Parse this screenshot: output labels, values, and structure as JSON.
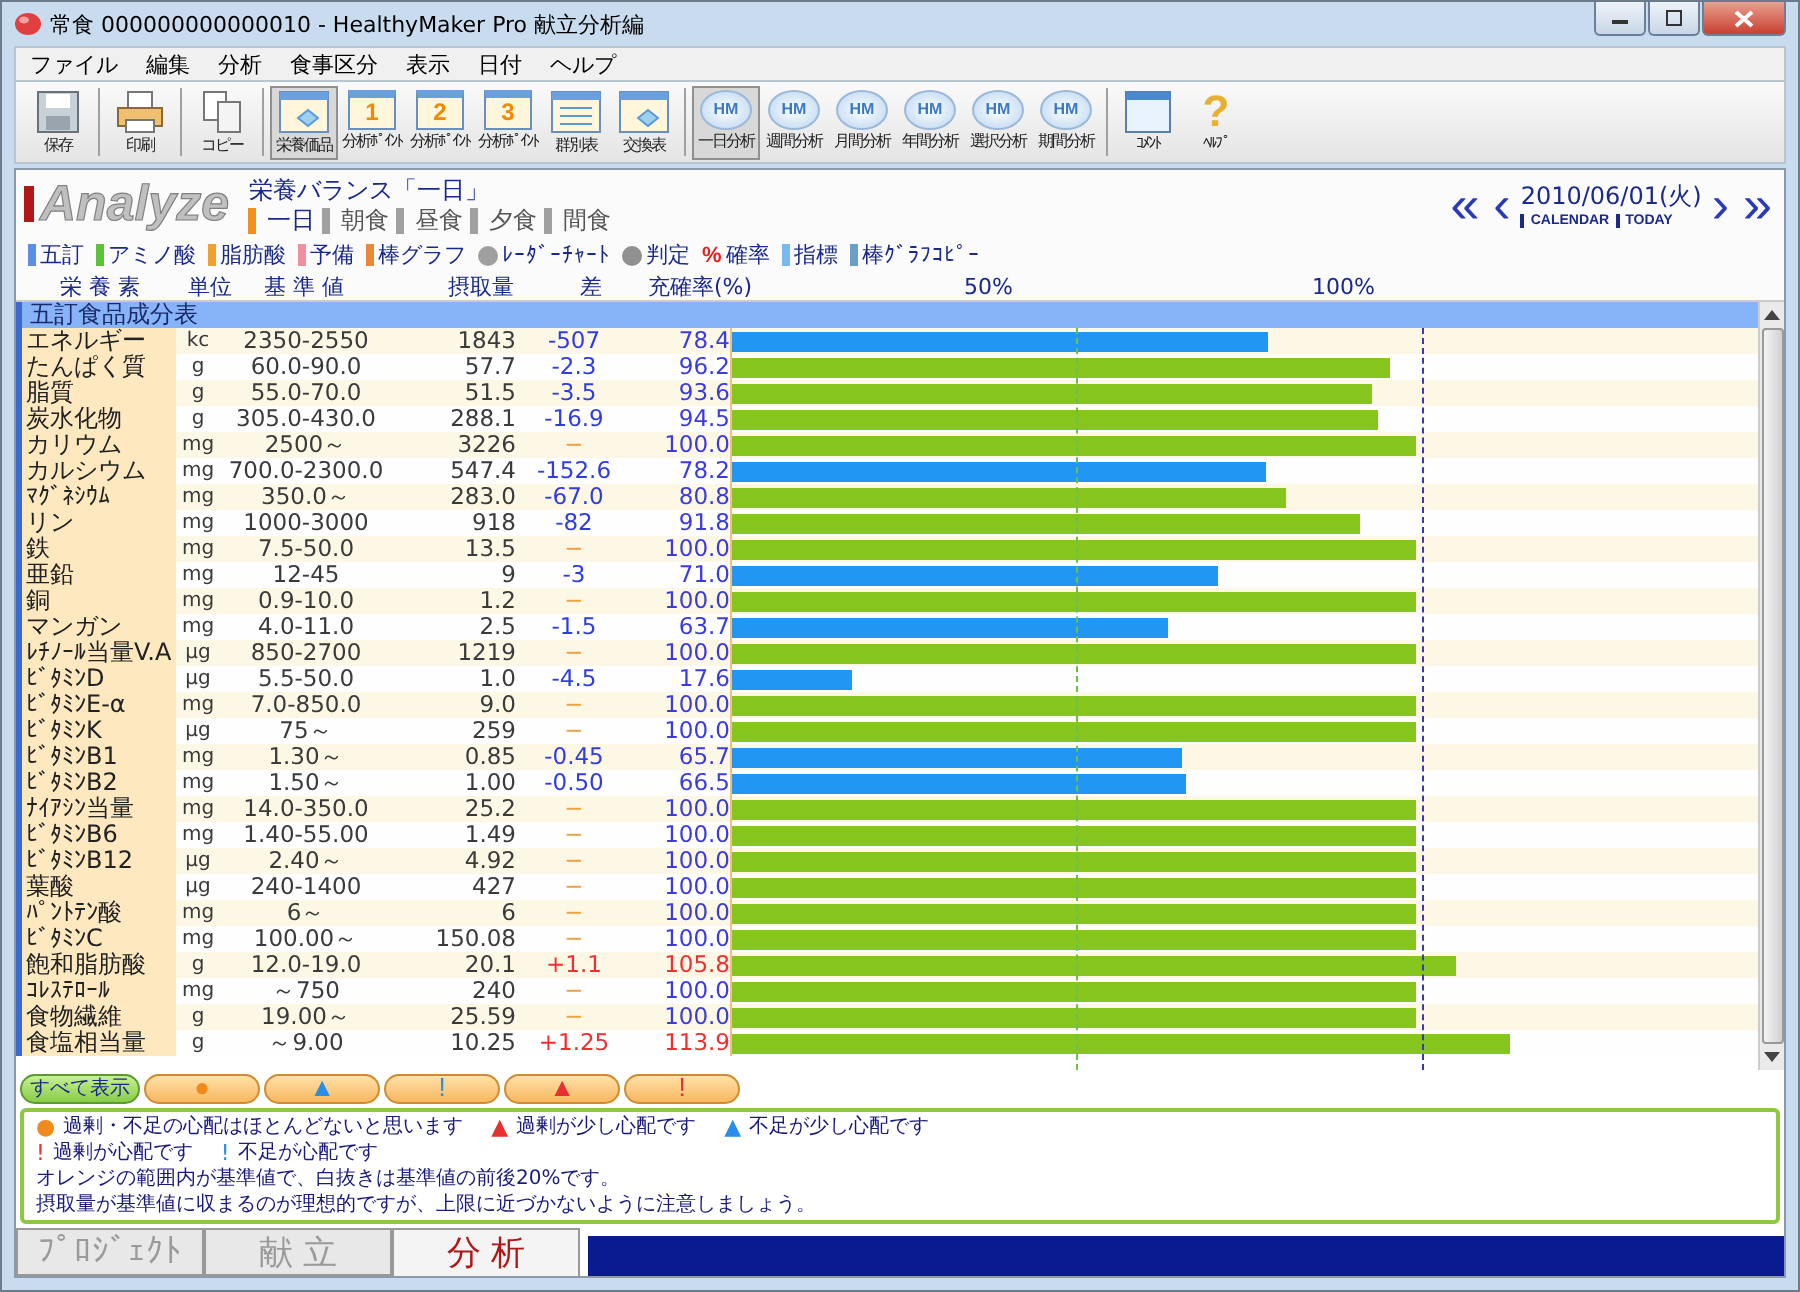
{
  "window": {
    "title": "常食 000000000000010 - HealthyMaker Pro 献立分析編"
  },
  "menu": [
    "ファイル",
    "編集",
    "分析",
    "食事区分",
    "表示",
    "日付",
    "ヘルプ"
  ],
  "toolbar": [
    {
      "kind": "save",
      "label": "保存",
      "selected": false
    },
    {
      "kind": "print",
      "label": "印刷",
      "selected": false
    },
    {
      "kind": "copy",
      "label": "コピー",
      "selected": false
    },
    {
      "kind": "sheet",
      "label": "栄養価品",
      "selected": true
    },
    {
      "kind": "number",
      "badge": "1",
      "label": "分析ﾎﾟｲﾝﾄ",
      "selected": false
    },
    {
      "kind": "number",
      "badge": "2",
      "label": "分析ﾎﾟｲﾝﾄ",
      "selected": false
    },
    {
      "kind": "number",
      "badge": "3",
      "label": "分析ﾎﾟｲﾝﾄ",
      "selected": false
    },
    {
      "kind": "table",
      "label": "群別表",
      "selected": false
    },
    {
      "kind": "sheet",
      "label": "交換表",
      "selected": false
    },
    {
      "kind": "cloud",
      "badge": "HM",
      "label": "一日分析",
      "selected": true
    },
    {
      "kind": "cloud",
      "badge": "HM",
      "label": "週間分析",
      "selected": false
    },
    {
      "kind": "cloud",
      "badge": "HM",
      "label": "月間分析",
      "selected": false
    },
    {
      "kind": "cloud",
      "badge": "HM",
      "label": "年間分析",
      "selected": false
    },
    {
      "kind": "cloud",
      "badge": "HM",
      "label": "選択分析",
      "selected": false
    },
    {
      "kind": "cloud",
      "badge": "HM",
      "label": "期間分析",
      "selected": false
    },
    {
      "kind": "comment",
      "label": "ｺﾒﾝﾄ",
      "selected": false
    },
    {
      "kind": "help",
      "badge": "?",
      "label": "ﾍﾙﾌﾟ",
      "selected": false
    }
  ],
  "header": {
    "logo": "Analyze",
    "title": "栄養バランス「一日」",
    "meals": [
      {
        "label": "一日",
        "selected": true
      },
      {
        "label": "朝食",
        "selected": false
      },
      {
        "label": "昼食",
        "selected": false
      },
      {
        "label": "夕食",
        "selected": false
      },
      {
        "label": "間食",
        "selected": false
      }
    ],
    "date": "2010/06/01(火)",
    "calendar": "CALENDAR",
    "today": "TODAY",
    "first": "«",
    "prev": "‹",
    "next": "›",
    "last": "»"
  },
  "toggles": [
    {
      "kind": "square",
      "color": "#5b8fe6",
      "label": "五訂"
    },
    {
      "kind": "square",
      "color": "#5cc23c",
      "label": "アミノ酸"
    },
    {
      "kind": "square",
      "color": "#f0a030",
      "label": "脂肪酸"
    },
    {
      "kind": "square",
      "color": "#f08fa0",
      "label": "予備"
    },
    {
      "kind": "square",
      "color": "#e8883a",
      "label": "棒グラフ"
    },
    {
      "kind": "circle",
      "color": "#a0a0a0",
      "label": "ﾚｰﾀﾞｰﾁｬｰﾄ"
    },
    {
      "kind": "circle",
      "color": "#909090",
      "label": "判定"
    },
    {
      "kind": "glyph",
      "glyph": "%",
      "label": "確率"
    },
    {
      "kind": "square",
      "color": "#7ab8f0",
      "label": "指標"
    },
    {
      "kind": "square",
      "color": "#6aa0c8",
      "label": "棒ｸﾞﾗﾌｺﾋﾟｰ"
    }
  ],
  "table": {
    "columns": [
      "栄 養 素",
      "単位",
      "基 準 値",
      "摂取量",
      "差",
      "充確率(%)",
      "50%",
      "100%"
    ],
    "group": "五訂食品成分表",
    "rows": [
      {
        "name": "エネルギー",
        "unit": "kc",
        "standard": "2350-2550",
        "intake": "1843",
        "diff": "-507",
        "rate": "78.4",
        "kind": "low",
        "level": 0.523
      },
      {
        "name": "たんぱく質",
        "unit": "g",
        "standard": "60.0-90.0",
        "intake": "57.7",
        "diff": "-2.3",
        "rate": "96.2",
        "kind": "short",
        "level": 0.641
      },
      {
        "name": "脂質",
        "unit": "g",
        "standard": "55.0-70.0",
        "intake": "51.5",
        "diff": "-3.5",
        "rate": "93.6",
        "kind": "short",
        "level": 0.624
      },
      {
        "name": "炭水化物",
        "unit": "g",
        "standard": "305.0-430.0",
        "intake": "288.1",
        "diff": "-16.9",
        "rate": "94.5",
        "kind": "short",
        "level": 0.63
      },
      {
        "name": "カリウム",
        "unit": "mg",
        "standard": "2500～",
        "intake": "3226",
        "diff": "−",
        "rate": "100.0",
        "kind": "ok",
        "level": 0.667
      },
      {
        "name": "カルシウム",
        "unit": "mg",
        "standard": "700.0-2300.0",
        "intake": "547.4",
        "diff": "-152.6",
        "rate": "78.2",
        "kind": "low",
        "level": 0.521
      },
      {
        "name": "ﾏｸﾞﾈｼｳﾑ",
        "unit": "mg",
        "standard": "350.0～",
        "intake": "283.0",
        "diff": "-67.0",
        "rate": "80.8",
        "kind": "short",
        "level": 0.539
      },
      {
        "name": "リン",
        "unit": "mg",
        "standard": "1000-3000",
        "intake": "918",
        "diff": "-82",
        "rate": "91.8",
        "kind": "short",
        "level": 0.612
      },
      {
        "name": "鉄",
        "unit": "mg",
        "standard": "7.5-50.0",
        "intake": "13.5",
        "diff": "−",
        "rate": "100.0",
        "kind": "ok",
        "level": 0.667
      },
      {
        "name": "亜鉛",
        "unit": "mg",
        "standard": "12-45",
        "intake": "9",
        "diff": "-3",
        "rate": "71.0",
        "kind": "low",
        "level": 0.473
      },
      {
        "name": "銅",
        "unit": "mg",
        "standard": "0.9-10.0",
        "intake": "1.2",
        "diff": "−",
        "rate": "100.0",
        "kind": "ok",
        "level": 0.667
      },
      {
        "name": "マンガン",
        "unit": "mg",
        "standard": "4.0-11.0",
        "intake": "2.5",
        "diff": "-1.5",
        "rate": "63.7",
        "kind": "low",
        "level": 0.425
      },
      {
        "name": "ﾚﾁﾉｰﾙ当量V.A",
        "unit": "μg",
        "standard": "850-2700",
        "intake": "1219",
        "diff": "−",
        "rate": "100.0",
        "kind": "ok",
        "level": 0.667
      },
      {
        "name": "ﾋﾞﾀﾐﾝD",
        "unit": "μg",
        "standard": "5.5-50.0",
        "intake": "1.0",
        "diff": "-4.5",
        "rate": "17.6",
        "kind": "low",
        "level": 0.117
      },
      {
        "name": "ﾋﾞﾀﾐﾝE-α",
        "unit": "mg",
        "standard": "7.0-850.0",
        "intake": "9.0",
        "diff": "−",
        "rate": "100.0",
        "kind": "ok",
        "level": 0.667
      },
      {
        "name": "ﾋﾞﾀﾐﾝK",
        "unit": "μg",
        "standard": "75～",
        "intake": "259",
        "diff": "−",
        "rate": "100.0",
        "kind": "ok",
        "level": 0.667
      },
      {
        "name": "ﾋﾞﾀﾐﾝB1",
        "unit": "mg",
        "standard": "1.30～",
        "intake": "0.85",
        "diff": "-0.45",
        "rate": "65.7",
        "kind": "low",
        "level": 0.438
      },
      {
        "name": "ﾋﾞﾀﾐﾝB2",
        "unit": "mg",
        "standard": "1.50～",
        "intake": "1.00",
        "diff": "-0.50",
        "rate": "66.5",
        "kind": "low",
        "level": 0.443
      },
      {
        "name": "ﾅｲｱｼﾝ当量",
        "unit": "mg",
        "standard": "14.0-350.0",
        "intake": "25.2",
        "diff": "−",
        "rate": "100.0",
        "kind": "ok",
        "level": 0.667
      },
      {
        "name": "ﾋﾞﾀﾐﾝB6",
        "unit": "mg",
        "standard": "1.40-55.00",
        "intake": "1.49",
        "diff": "−",
        "rate": "100.0",
        "kind": "ok",
        "level": 0.667
      },
      {
        "name": "ﾋﾞﾀﾐﾝB12",
        "unit": "μg",
        "standard": "2.40～",
        "intake": "4.92",
        "diff": "−",
        "rate": "100.0",
        "kind": "ok",
        "level": 0.667
      },
      {
        "name": "葉酸",
        "unit": "μg",
        "standard": "240-1400",
        "intake": "427",
        "diff": "−",
        "rate": "100.0",
        "kind": "ok",
        "level": 0.667
      },
      {
        "name": "ﾊﾟﾝﾄﾃﾝ酸",
        "unit": "mg",
        "standard": "6～",
        "intake": "6",
        "diff": "−",
        "rate": "100.0",
        "kind": "ok",
        "level": 0.667
      },
      {
        "name": "ﾋﾞﾀﾐﾝC",
        "unit": "mg",
        "standard": "100.00～",
        "intake": "150.08",
        "diff": "−",
        "rate": "100.0",
        "kind": "ok",
        "level": 0.667
      },
      {
        "name": "飽和脂肪酸",
        "unit": "g",
        "standard": "12.0-19.0",
        "intake": "20.1",
        "diff": "+1.1",
        "rate": "105.8",
        "kind": "high",
        "level": 0.705
      },
      {
        "name": "ｺﾚｽﾃﾛｰﾙ",
        "unit": "mg",
        "standard": "～750",
        "intake": "240",
        "diff": "−",
        "rate": "100.0",
        "kind": "ok",
        "level": 0.667
      },
      {
        "name": "食物繊維",
        "unit": "g",
        "standard": "19.00～",
        "intake": "25.59",
        "diff": "−",
        "rate": "100.0",
        "kind": "ok",
        "level": 0.667
      },
      {
        "name": "食塩相当量",
        "unit": "g",
        "standard": "～9.00",
        "intake": "10.25",
        "diff": "+1.25",
        "rate": "113.9",
        "kind": "high",
        "level": 0.759
      }
    ]
  },
  "filters": [
    {
      "kind": "text",
      "label": "すべて表示",
      "selected": true
    },
    {
      "kind": "glyph",
      "label": "●",
      "color": "#f08a1c",
      "selected": false
    },
    {
      "kind": "glyph",
      "label": "▲",
      "color": "#2a8ee8",
      "selected": false
    },
    {
      "kind": "glyph",
      "label": "!",
      "color": "#2a8ee8",
      "selected": false
    },
    {
      "kind": "glyph",
      "label": "▲",
      "color": "#e83030",
      "selected": false
    },
    {
      "kind": "glyph",
      "label": "!",
      "color": "#e83030",
      "selected": false
    }
  ],
  "legend": [
    [
      {
        "glyph": "●",
        "color": "#f08a1c",
        "text": "過剰・不足の心配はほとんどないと思います"
      },
      {
        "glyph": "▲",
        "color": "#e83030",
        "text": "過剰が少し心配です"
      },
      {
        "glyph": "▲",
        "color": "#2a8ee8",
        "text": "不足が少し心配です"
      }
    ],
    [
      {
        "glyph": "!",
        "color": "#e83030",
        "text": "過剰が心配です"
      },
      {
        "glyph": "!",
        "color": "#2a8ee8",
        "text": "不足が心配です"
      }
    ]
  ],
  "notes": [
    "オレンジの範囲内が基準値で、白抜きは基準値の前後20%です。",
    "摂取量が基準値に収まるのが理想的ですが、上限に近づかないように注意しましょう。"
  ],
  "bottom_tabs": [
    {
      "label": "ﾌﾟﾛｼﾞｪｸﾄ",
      "selected": false
    },
    {
      "label": "献 立",
      "selected": false
    },
    {
      "label": "分 析",
      "selected": true
    }
  ]
}
